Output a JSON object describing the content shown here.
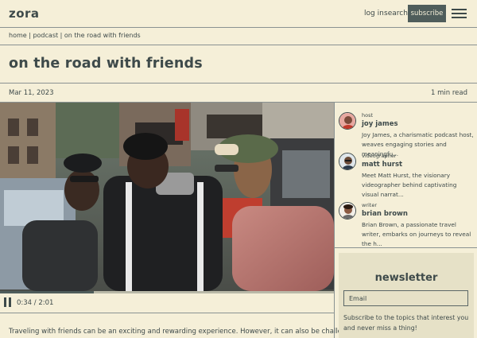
{
  "header": {
    "logo": "zora",
    "nav": {
      "login": "log in",
      "search": "search"
    },
    "subscribe_label": "subscribe"
  },
  "breadcrumb": "home | podcast | on the road with friends",
  "article": {
    "title": "on the road with friends",
    "date": "Mar 11, 2023",
    "read_time": "1 min read",
    "intro": "Traveling with friends can be an exciting and rewarding experience. However, it can also be challenging to"
  },
  "player": {
    "time": "0:34 / 2:01",
    "progress": 0.28
  },
  "people": [
    {
      "role": "host",
      "name": "joy james",
      "desc": "Joy James, a charismatic podcast host, weaves engaging stories and meaningfu..."
    },
    {
      "role": "videographer",
      "name": "matt hurst",
      "desc": "Meet Matt Hurst, the visionary videographer behind captivating visual narrat..."
    },
    {
      "role": "writer",
      "name": "brian brown",
      "desc": "Brian Brown, a passionate travel writer, embarks on journeys to reveal the h..."
    }
  ],
  "newsletter": {
    "title": "newsletter",
    "email_placeholder": "Email",
    "text": "Subscribe to the topics that interest you and never miss a thing!"
  },
  "colors": {
    "background": "#f5efd8",
    "text": "#3e4a4a",
    "button": "#4f5d5b",
    "newsletter_bg": "#e6e1c7"
  },
  "icons": {
    "menu": "hamburger-menu-icon",
    "pause": "pause-icon"
  }
}
